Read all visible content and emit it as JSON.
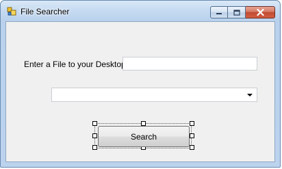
{
  "window": {
    "title": "File Searcher"
  },
  "form": {
    "file_label": "Enter a File to your Desktop:",
    "file_input_value": "",
    "results_combo_value": "",
    "search_button_label": "Search"
  },
  "icons": {
    "app": "app-forms-icon",
    "minimize": "minimize-icon",
    "maximize": "maximize-icon",
    "close": "close-icon",
    "combo_arrow": "chevron-down-icon"
  },
  "colors": {
    "frame": "#bcd3ee",
    "client_bg": "#f0f0f0",
    "close_button": "#c14b33"
  }
}
